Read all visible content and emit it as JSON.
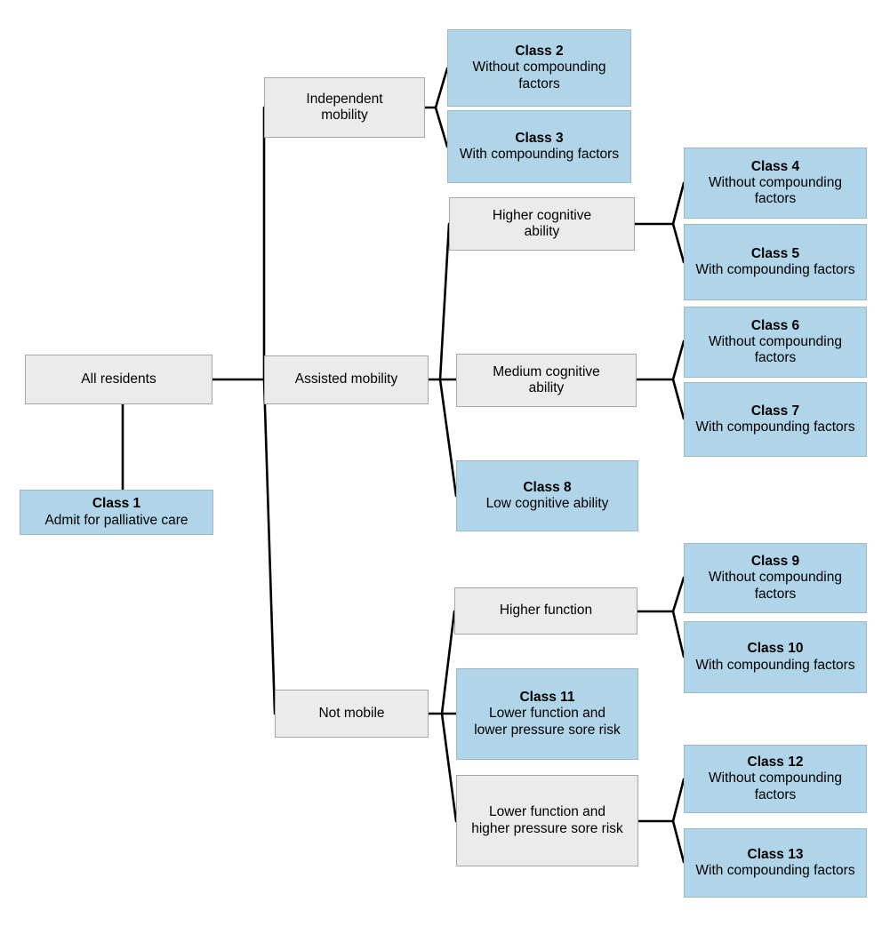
{
  "diagram": {
    "type": "decision-tree",
    "palette": {
      "decision_fill": "#ebebeb",
      "decision_border": "#a6a6a6",
      "leaf_fill": "#b0d4e8",
      "leaf_border": "#9ab9cc",
      "edge_color": "#000000",
      "text_color": "#000000",
      "background": "#ffffff"
    },
    "nodes": {
      "root": {
        "label": "All residents"
      },
      "class1": {
        "title": "Class 1",
        "desc": "Admit for palliative care"
      },
      "independent_mobility": {
        "label": "Independent mobility"
      },
      "class2": {
        "title": "Class 2",
        "desc": "Without compounding factors"
      },
      "class3": {
        "title": "Class 3",
        "desc": "With compounding factors"
      },
      "assisted_mobility": {
        "label": "Assisted mobility"
      },
      "higher_cognitive": {
        "label": "Higher cognitive ability"
      },
      "class4": {
        "title": "Class 4",
        "desc": "Without compounding factors"
      },
      "class5": {
        "title": "Class 5",
        "desc": "With compounding factors"
      },
      "medium_cognitive": {
        "label": "Medium cognitive ability"
      },
      "class6": {
        "title": "Class 6",
        "desc": "Without compounding factors"
      },
      "class7": {
        "title": "Class 7",
        "desc": "With compounding factors"
      },
      "class8": {
        "title": "Class 8",
        "desc": "Low cognitive ability"
      },
      "not_mobile": {
        "label": "Not mobile"
      },
      "higher_function": {
        "label": "Higher function"
      },
      "class9": {
        "title": "Class 9",
        "desc": "Without compounding factors"
      },
      "class10": {
        "title": "Class 10",
        "desc": "With compounding factors"
      },
      "class11": {
        "title": "Class 11",
        "desc": "Lower function and lower pressure sore risk"
      },
      "lower_function_higher_risk": {
        "label": "Lower function and higher pressure sore risk"
      },
      "class12": {
        "title": "Class 12",
        "desc": "Without compounding factors"
      },
      "class13": {
        "title": "Class 13",
        "desc": "With compounding factors"
      }
    },
    "edges": [
      {
        "from": "root",
        "to": "class1"
      },
      {
        "from": "root",
        "to": "independent_mobility"
      },
      {
        "from": "root",
        "to": "assisted_mobility"
      },
      {
        "from": "root",
        "to": "not_mobile"
      },
      {
        "from": "independent_mobility",
        "to": "class2"
      },
      {
        "from": "independent_mobility",
        "to": "class3"
      },
      {
        "from": "assisted_mobility",
        "to": "higher_cognitive"
      },
      {
        "from": "assisted_mobility",
        "to": "medium_cognitive"
      },
      {
        "from": "assisted_mobility",
        "to": "class8"
      },
      {
        "from": "higher_cognitive",
        "to": "class4"
      },
      {
        "from": "higher_cognitive",
        "to": "class5"
      },
      {
        "from": "medium_cognitive",
        "to": "class6"
      },
      {
        "from": "medium_cognitive",
        "to": "class7"
      },
      {
        "from": "not_mobile",
        "to": "higher_function"
      },
      {
        "from": "not_mobile",
        "to": "class11"
      },
      {
        "from": "not_mobile",
        "to": "lower_function_higher_risk"
      },
      {
        "from": "higher_function",
        "to": "class9"
      },
      {
        "from": "higher_function",
        "to": "class10"
      },
      {
        "from": "lower_function_higher_risk",
        "to": "class12"
      },
      {
        "from": "lower_function_higher_risk",
        "to": "class13"
      }
    ]
  }
}
